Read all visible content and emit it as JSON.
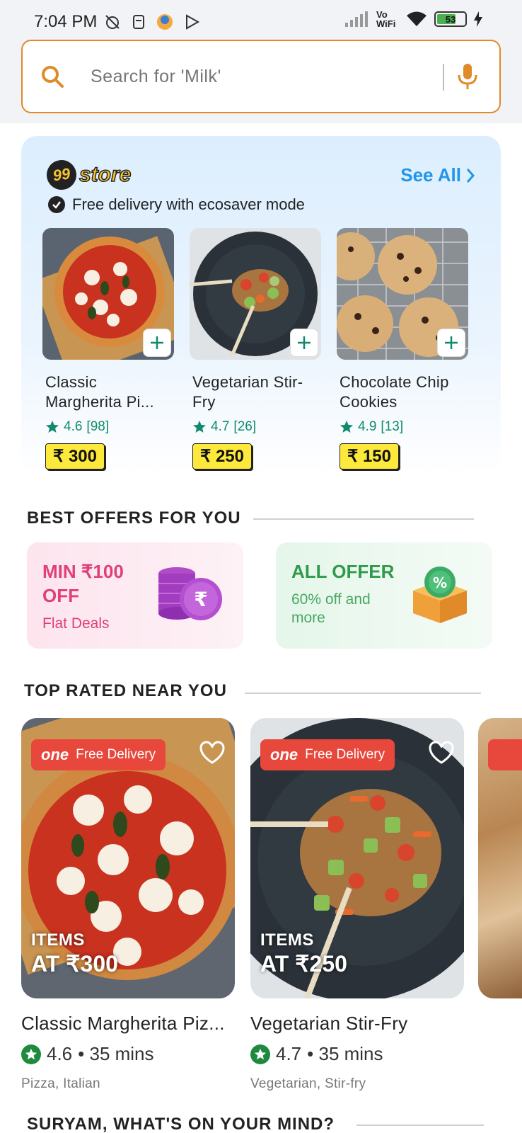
{
  "status_bar": {
    "time": "7:04 PM",
    "network_label": "Vo WiFi",
    "battery": "53"
  },
  "search": {
    "placeholder": "Search for 'Milk'"
  },
  "store": {
    "brand_number": "99",
    "brand_word": "store",
    "see_all": "See All",
    "subtitle": "Free delivery with ecosaver mode",
    "items": [
      {
        "name": "Classic Margherita Pi...",
        "rating": "4.6",
        "count": "[98]",
        "price": "₹ 300"
      },
      {
        "name": "Vegetarian Stir-Fry",
        "rating": "4.7",
        "count": "[26]",
        "price": "₹ 250"
      },
      {
        "name": "Chocolate Chip Cookies",
        "rating": "4.9",
        "count": "[13]",
        "price": "₹ 150"
      }
    ]
  },
  "offers": {
    "title": "BEST OFFERS FOR YOU",
    "items": [
      {
        "title": "MIN ₹100 OFF",
        "subtitle": "Flat Deals"
      },
      {
        "title": "ALL OFFER",
        "subtitle": "60% off and more"
      }
    ]
  },
  "top_rated": {
    "title": "TOP RATED NEAR YOU",
    "badge_one": "one",
    "badge_text": "Free Delivery",
    "items": [
      {
        "items_line1": "ITEMS",
        "items_line2": "AT ₹300",
        "name": "Classic Margherita Piz...",
        "rating": "4.6",
        "time": "• 35 mins",
        "cuisine": "Pizza, Italian"
      },
      {
        "items_line1": "ITEMS",
        "items_line2": "AT ₹250",
        "name": "Vegetarian Stir-Fry",
        "rating": "4.7",
        "time": "• 35 mins",
        "cuisine": "Vegetarian, Stir-fry"
      }
    ]
  },
  "mind": {
    "title": "SURYAM, WHAT'S ON YOUR MIND?"
  },
  "colors": {
    "accent_orange": "#e08a2a",
    "link_blue": "#2196e8",
    "rating_green": "#0f8a6e",
    "price_yellow": "#fde93b",
    "badge_red": "#e8473c"
  }
}
